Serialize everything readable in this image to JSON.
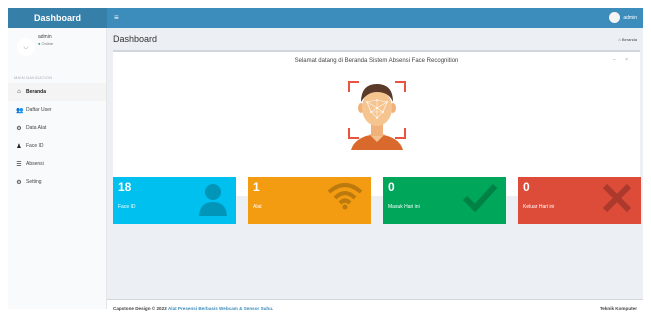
{
  "header": {
    "logo": "Dashboard",
    "menu_icon": "hamburger-icon",
    "user": "admin"
  },
  "sidebar": {
    "user_name": "admin",
    "user_status": "Online",
    "nav_header": "MAIN NAVIGATION",
    "items": [
      {
        "label": "Beranda",
        "icon": "home-icon",
        "active": true
      },
      {
        "label": "Daftar User",
        "icon": "users-icon",
        "active": false
      },
      {
        "label": "Data Alat",
        "icon": "cogs-icon",
        "active": false
      },
      {
        "label": "Face ID",
        "icon": "user-icon",
        "active": false
      },
      {
        "label": "Absensi",
        "icon": "list-icon",
        "active": false
      },
      {
        "label": "Setting",
        "icon": "gear-icon",
        "active": false
      }
    ]
  },
  "main": {
    "title": "Dashboard",
    "breadcrumb": "Beranda",
    "welcome": "Selamat datang di Beranda Sistem Absensi Face Recognition",
    "box_tools": "– ×",
    "stats": [
      {
        "value": "18",
        "label": "Face ID",
        "color": "#00c0ef",
        "icon": "user-icon"
      },
      {
        "value": "1",
        "label": "Alat",
        "color": "#f39c12",
        "icon": "wifi-icon"
      },
      {
        "value": "0",
        "label": "Masuk Hari ini",
        "color": "#00a65a",
        "icon": "check-icon"
      },
      {
        "value": "0",
        "label": "Keluar Hari ini",
        "color": "#dd4b39",
        "icon": "close-icon"
      }
    ]
  },
  "footer": {
    "left_prefix": "Capstone Design © 2023",
    "left_highlight": "Alat Presensi Berbasis Webcam & Sensor Suhu.",
    "right": "Teknik Komputer"
  }
}
